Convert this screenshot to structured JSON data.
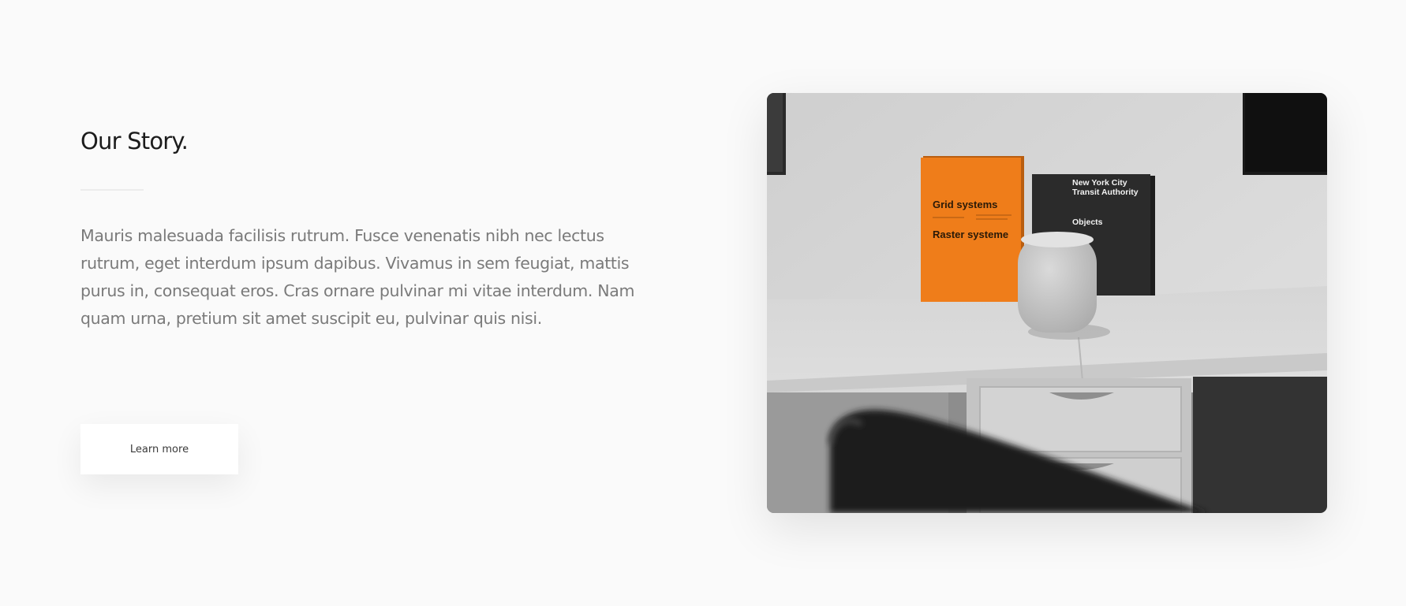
{
  "story": {
    "title": "Our Story.",
    "body": "Mauris malesuada facilisis rutrum. Fusce venenatis nibh nec lectus rutrum, eget interdum ipsum dapibus. Vivamus in sem feugiat, mattis purus in, consequat eros. Cras ornare pulvinar mi vitae interdum. Nam quam urna, pretium sit amet suscipit eu, pulvinar quis nisi.",
    "button_label": "Learn more"
  },
  "photo": {
    "orange_book": {
      "title_1": "Grid systems",
      "title_2": "Raster systeme"
    },
    "black_book": {
      "title_line_1": "New York City",
      "title_line_2": "Transit Authority",
      "subtitle": "Objects"
    }
  },
  "colors": {
    "background": "#fafafa",
    "heading": "#1c1c1c",
    "body_text": "#7a7a7a",
    "accent_orange": "#ef7d1a"
  }
}
